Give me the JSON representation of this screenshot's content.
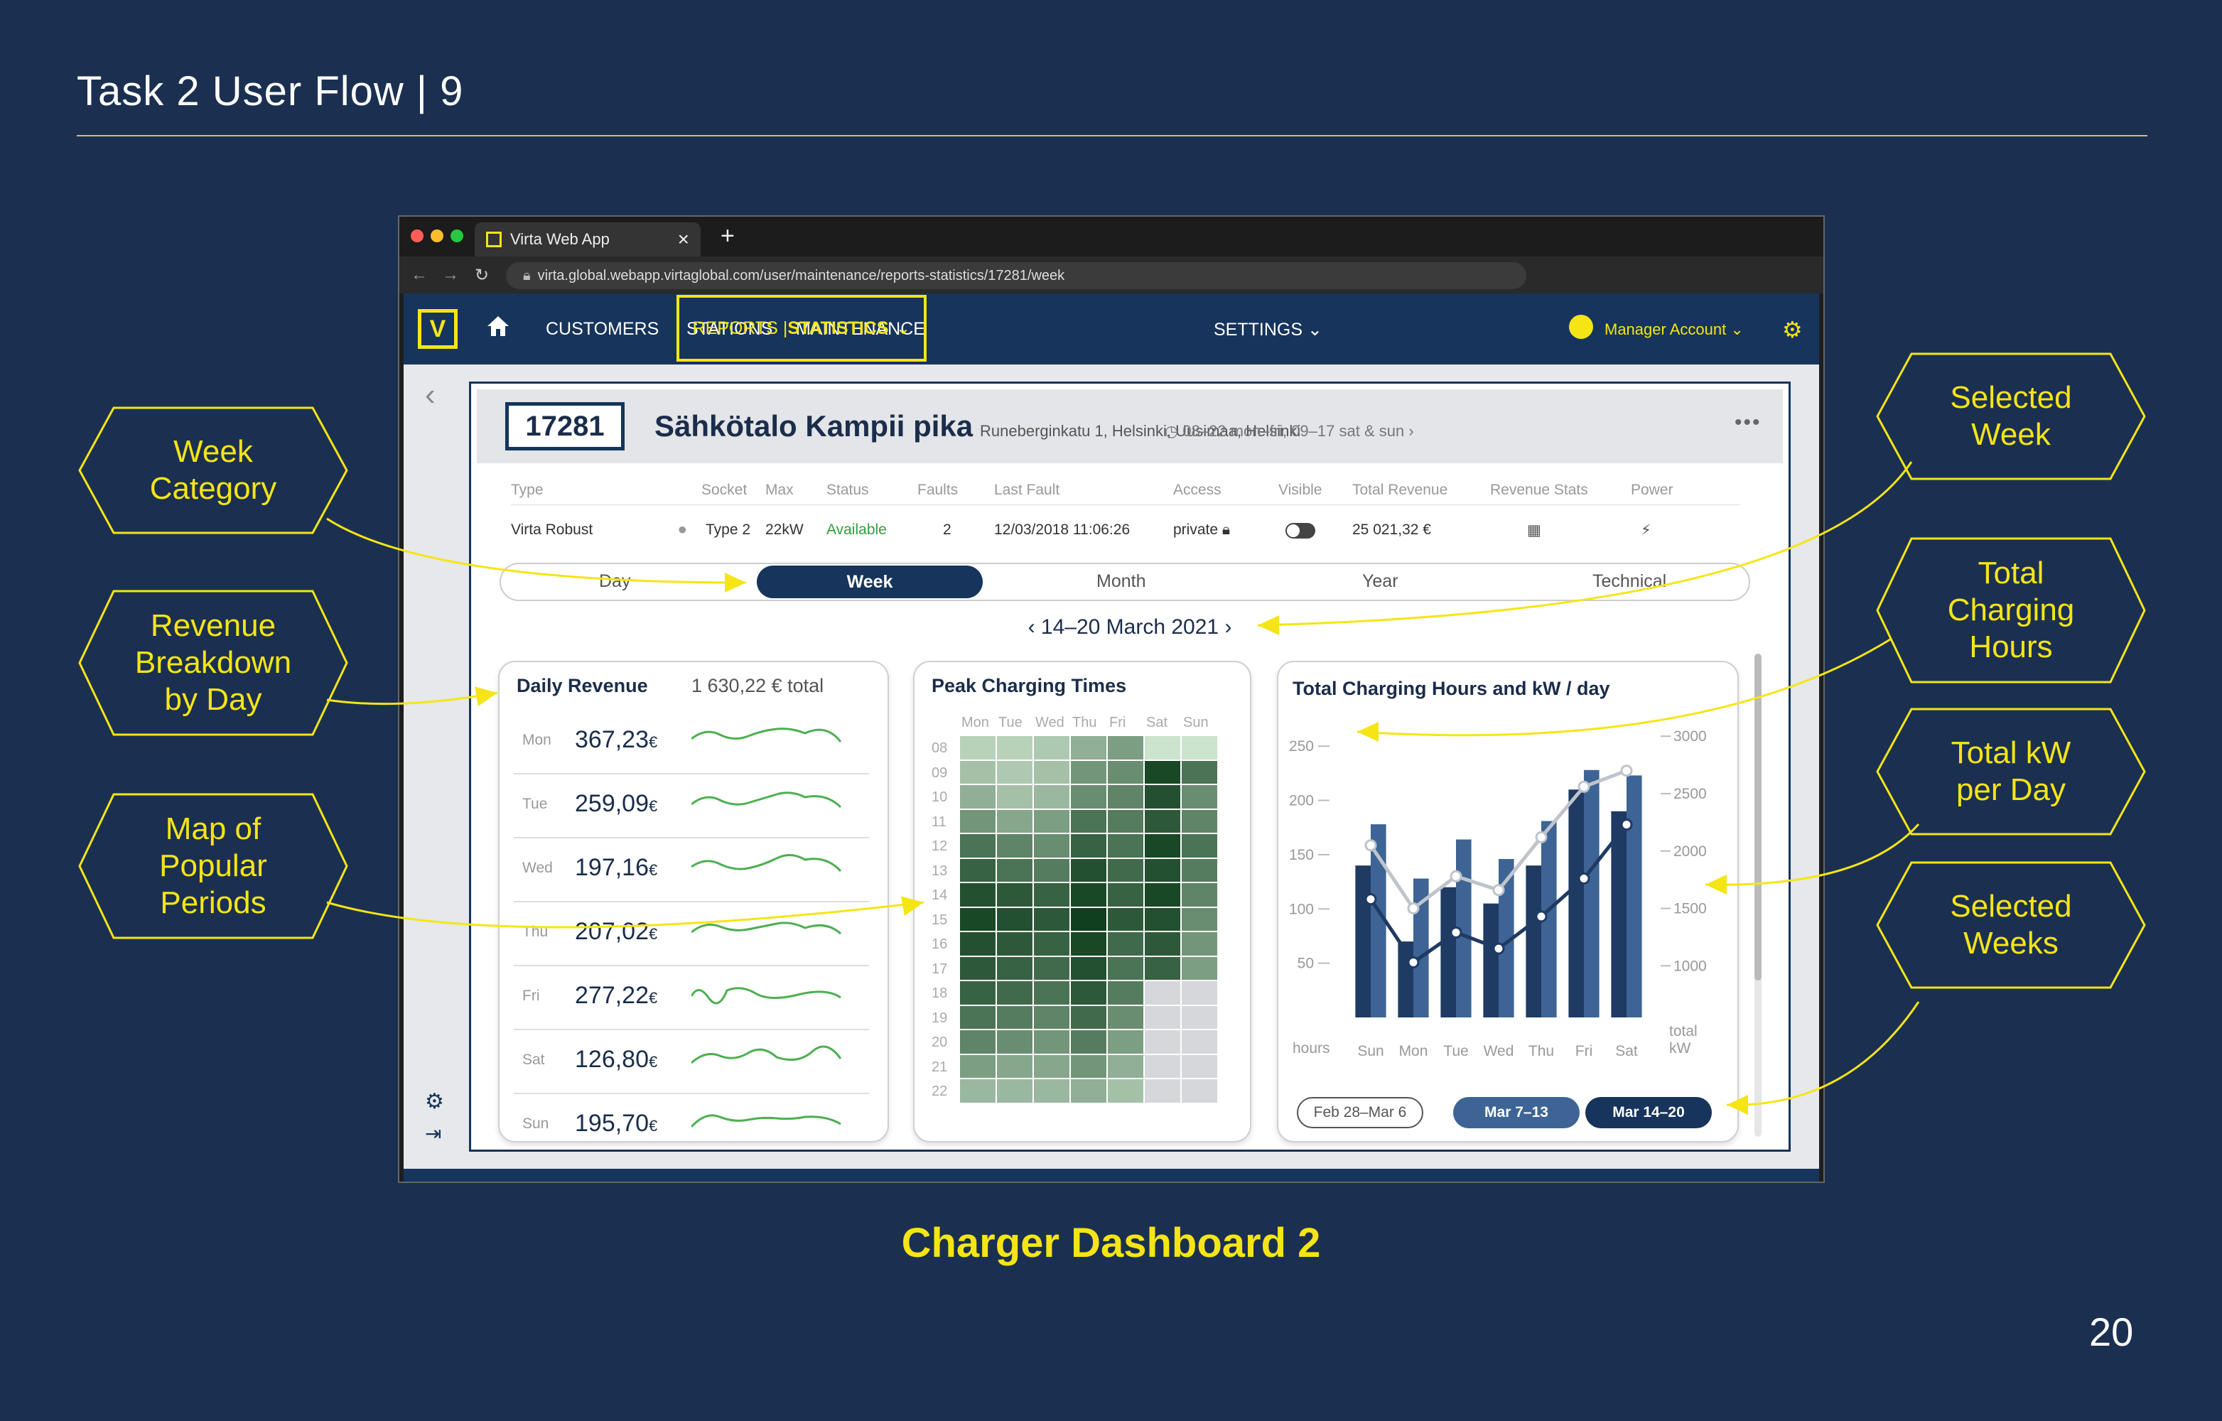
{
  "slide": {
    "title": "Task 2 User Flow  |  9",
    "caption": "Charger Dashboard 2",
    "page_number": "20"
  },
  "callouts": [
    {
      "text": "Week\nCategory"
    },
    {
      "text": "Revenue\nBreakdown\nby Day"
    },
    {
      "text": "Map of\nPopular\nPeriods"
    },
    {
      "text": "Selected\nWeek"
    },
    {
      "text": "Total\nCharging\nHours"
    },
    {
      "text": "Total kW\nper Day"
    },
    {
      "text": "Selected\nWeeks"
    }
  ],
  "browser": {
    "tab_title": "Virta Web App",
    "url": "virta.global.webapp.virtaglobal.com/user/maintenance/reports-statistics/17281/week"
  },
  "nav": {
    "customers": "CUSTOMERS",
    "stations": "STATIONS",
    "maintenance": "MAINTENANCE",
    "reports": "REPORTS | ",
    "statistics": "STATISTICS",
    "settings": "SETTINGS",
    "account": "Manager Account"
  },
  "station": {
    "id": "17281",
    "name": "Sähkötalo Kampii pika",
    "address": "Runeberginkatu 1, Helsinki, Uusimaa, Helsinki",
    "hours": "08–22 mon–fri, 09–17 sat & sun",
    "headers": {
      "type": "Type",
      "socket": "Socket",
      "max": "Max",
      "status": "Status",
      "faults": "Faults",
      "last_fault": "Last Fault",
      "access": "Access",
      "visible": "Visible",
      "total_revenue": "Total Revenue",
      "revenue_stats": "Revenue Stats",
      "power": "Power"
    },
    "values": {
      "type": "Virta Robust",
      "socket": "Type 2",
      "max": "22kW",
      "status": "Available",
      "faults": "2",
      "last_fault": "12/03/2018 11:06:26",
      "access": "private",
      "total_revenue": "25 021,32 €"
    }
  },
  "period_tabs": {
    "day": "Day",
    "week": "Week",
    "month": "Month",
    "year": "Year",
    "technical": "Technical",
    "selected": "Week"
  },
  "date_range": "14–20 March 2021",
  "daily_revenue": {
    "title": "Daily Revenue",
    "total": "1 630,22 € total",
    "rows": [
      {
        "day": "Mon",
        "value": "367,23",
        "unit": "€"
      },
      {
        "day": "Tue",
        "value": "259,09",
        "unit": "€"
      },
      {
        "day": "Wed",
        "value": "197,16",
        "unit": "€"
      },
      {
        "day": "Thu",
        "value": "207,02",
        "unit": "€"
      },
      {
        "day": "Fri",
        "value": "277,22",
        "unit": "€"
      },
      {
        "day": "Sat",
        "value": "126,80",
        "unit": "€"
      },
      {
        "day": "Sun",
        "value": "195,70",
        "unit": "€"
      }
    ]
  },
  "peak_times": {
    "title": "Peak Charging Times",
    "days": [
      "Mon",
      "Tue",
      "Wed",
      "Thu",
      "Fri",
      "Sat",
      "Sun"
    ],
    "hours": [
      "08",
      "09",
      "10",
      "11",
      "12",
      "13",
      "14",
      "15",
      "16",
      "17",
      "18",
      "19",
      "20",
      "21",
      "22"
    ],
    "intensity": [
      [
        0.15,
        0.15,
        0.2,
        0.35,
        0.45,
        0.05,
        0.05
      ],
      [
        0.25,
        0.2,
        0.25,
        0.5,
        0.55,
        0.95,
        0.7
      ],
      [
        0.35,
        0.25,
        0.3,
        0.55,
        0.6,
        0.9,
        0.55
      ],
      [
        0.5,
        0.4,
        0.45,
        0.7,
        0.65,
        0.85,
        0.6
      ],
      [
        0.7,
        0.6,
        0.55,
        0.8,
        0.7,
        0.95,
        0.7
      ],
      [
        0.8,
        0.7,
        0.65,
        0.9,
        0.75,
        0.9,
        0.65
      ],
      [
        0.9,
        0.85,
        0.8,
        0.95,
        0.8,
        0.95,
        0.6
      ],
      [
        0.95,
        0.9,
        0.85,
        1.0,
        0.85,
        0.9,
        0.55
      ],
      [
        0.9,
        0.85,
        0.8,
        0.95,
        0.75,
        0.85,
        0.5
      ],
      [
        0.85,
        0.8,
        0.75,
        0.9,
        0.7,
        0.8,
        0.45
      ],
      [
        0.8,
        0.75,
        0.7,
        0.85,
        0.65,
        0,
        0
      ],
      [
        0.7,
        0.65,
        0.6,
        0.75,
        0.55,
        0,
        0
      ],
      [
        0.6,
        0.55,
        0.5,
        0.65,
        0.45,
        0,
        0
      ],
      [
        0.45,
        0.4,
        0.4,
        0.5,
        0.35,
        0,
        0
      ],
      [
        0.3,
        0.3,
        0.3,
        0.35,
        0.25,
        0,
        0
      ]
    ],
    "colors": {
      "low": "#d6ecd6",
      "high": "#0f3f1e",
      "closed": "#d5d7da"
    }
  },
  "chart_data": {
    "type": "bar",
    "title": "Total Charging Hours and kW / day",
    "categories": [
      "Sun",
      "Mon",
      "Tue",
      "Wed",
      "Thu",
      "Fri",
      "Sat"
    ],
    "series": [
      {
        "values": [
          140,
          70,
          120,
          105,
          140,
          210,
          190
        ],
        "axis": "left"
      },
      {
        "values": [
          1780,
          1280,
          1640,
          1460,
          1810,
          2280,
          2230
        ],
        "axis": "left"
      },
      {
        "values": [
          2050,
          1500,
          1780,
          1660,
          2120,
          2560,
          2700
        ],
        "axis": "right"
      },
      {
        "values": [
          1580,
          1030,
          1290,
          1150,
          1430,
          1760,
          2230
        ],
        "axis": "right"
      }
    ],
    "ylim": [
      0,
      275
    ],
    "y2lim": [
      550,
      3150
    ],
    "ylabel": "hours",
    "y2label": "total\nkW",
    "yticks": [
      50,
      100,
      150,
      200,
      250
    ],
    "y2ticks": [
      1000,
      1500,
      2000,
      2500,
      3000
    ],
    "week_chips": [
      "Feb 28–Mar 6",
      "Mar 7–13",
      "Mar 14–20"
    ]
  },
  "colors": {
    "navy": "#16345c",
    "yellow": "#f5e515",
    "green": "#4caf50"
  }
}
